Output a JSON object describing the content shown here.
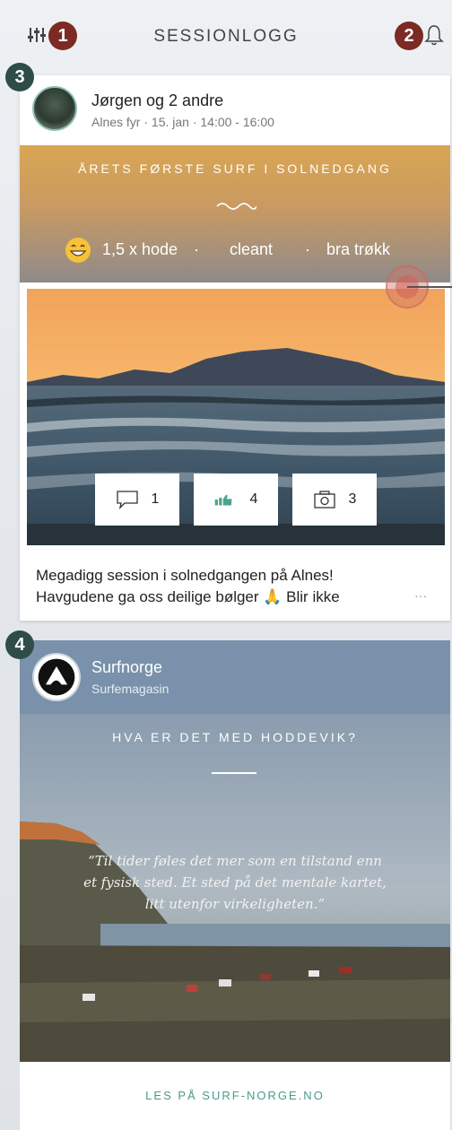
{
  "header": {
    "title": "SESSIONLOGG",
    "badge_left": "1",
    "badge_right": "2",
    "filter_icon": "filter-sliders-icon",
    "bell_icon": "bell-icon"
  },
  "annotations": {
    "card1_badge": "3",
    "card2_badge": "4"
  },
  "session_card": {
    "user": "Jørgen og 2 andre",
    "meta": "Alnes fyr · 15. jan · 14:00 - 16:00",
    "banner_title": "ÅRETS FØRSTE SURF I SOLNEDGANG",
    "conditions": {
      "wave": "1,5 x hode",
      "sep1": "·",
      "wind": "cleant",
      "sep2": "·",
      "crowd": "bra trøkk"
    },
    "stats": {
      "comments": "1",
      "likes": "4",
      "photos": "3"
    },
    "description_line1": "Megadigg session i solnedgangen på Alnes!",
    "description_line2": "Havgudene ga oss deilige bølger 🙏 Blir ikke",
    "more": "···"
  },
  "article_card": {
    "brand": "Surfnorge",
    "brand_type": "Surfemagasin",
    "title": "HVA ER DET MED HODDEVIK?",
    "quote_line1": "“Til tider føles det mer som en tilstand enn",
    "quote_line2": "et fysisk sted. Et sted på det mentale kartet,",
    "quote_line3": "litt utenfor virkeligheten.”",
    "link": "LES PÅ SURF-NORGE.NO"
  },
  "colors": {
    "badge_red": "#7c2a24",
    "badge_teal": "#2f4d48",
    "link_green": "#4a9a8a",
    "brand_header": "#7991aa"
  }
}
